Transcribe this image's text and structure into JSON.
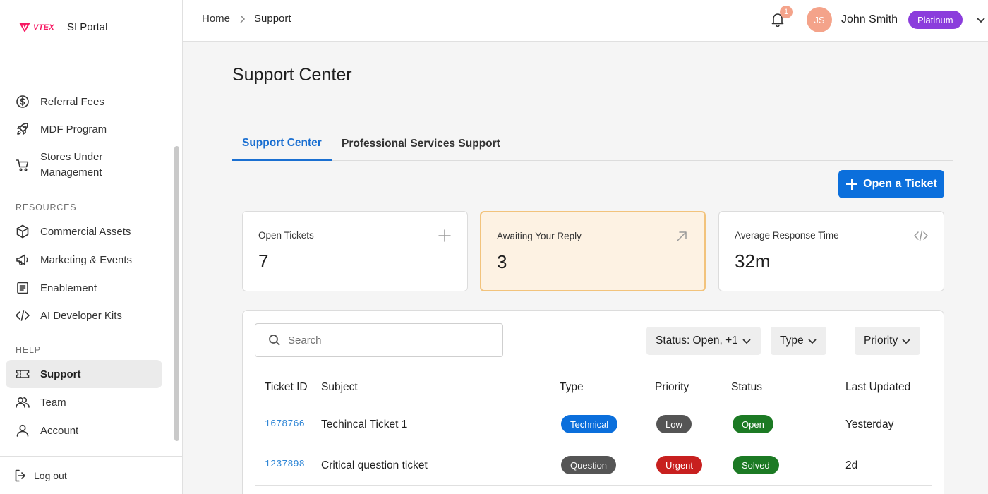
{
  "brand": {
    "logo_text": "VTEX",
    "title": "SI Portal",
    "brand_color": "#f71963"
  },
  "sidebar": {
    "items": [
      {
        "label": "Referral Fees",
        "icon": "dollar-circle-icon"
      },
      {
        "label": "MDF Program",
        "icon": "rocket-icon"
      },
      {
        "label": "Stores Under Management",
        "icon": "cart-icon"
      },
      {
        "label": "Commercial Assets",
        "icon": "box-icon"
      },
      {
        "label": "Marketing & Events",
        "icon": "megaphone-icon"
      },
      {
        "label": "Enablement",
        "icon": "document-icon"
      },
      {
        "label": "AI Developer Kits",
        "icon": "code-icon"
      },
      {
        "label": "Support",
        "icon": "ticket-icon",
        "active": true
      },
      {
        "label": "Team",
        "icon": "users-icon"
      },
      {
        "label": "Account",
        "icon": "user-icon"
      }
    ],
    "sections": {
      "resources": "RESOURCES",
      "help": "HELP"
    },
    "logout_label": "Log out"
  },
  "header": {
    "breadcrumb": {
      "home": "Home",
      "current": "Support"
    },
    "notifications_count": "1",
    "user": {
      "initials": "JS",
      "name": "John Smith",
      "plan": "Platinum"
    }
  },
  "main": {
    "title": "Support Center",
    "tabs": [
      {
        "label": "Support Center",
        "active": true
      },
      {
        "label": "Professional Services Support",
        "active": false
      }
    ],
    "open_ticket_label": "Open a Ticket",
    "stats": [
      {
        "label": "Open Tickets",
        "value": "7",
        "icon": "plus-icon"
      },
      {
        "label": "Awaiting Your Reply",
        "value": "3",
        "icon": "arrow-up-right-icon"
      },
      {
        "label": "Average Response Time",
        "value": "32m",
        "icon": "code-icon"
      }
    ],
    "search": {
      "placeholder": "Search",
      "value": ""
    },
    "filters": {
      "status": "Status: Open, +1",
      "type": "Type",
      "priority": "Priority"
    },
    "table": {
      "columns": [
        "Ticket ID",
        "Subject",
        "Type",
        "Priority",
        "Status",
        "Last Updated"
      ],
      "rows": [
        {
          "id": "1678766",
          "subject": "Techincal Ticket 1",
          "type": "Technical",
          "priority": "Low",
          "status": "Open",
          "updated": "Yesterday"
        },
        {
          "id": "1237898",
          "subject": "Critical question ticket",
          "type": "Question",
          "priority": "Urgent",
          "status": "Solved",
          "updated": "2d"
        }
      ]
    }
  },
  "colors": {
    "accent": "#0b6fdc",
    "plan_badge": "#8b3ddc",
    "pill_technical": "#0b6fdc",
    "pill_question": "#555555",
    "pill_low": "#555555",
    "pill_urgent": "#c8201f",
    "pill_status_green": "#1c7a24"
  }
}
